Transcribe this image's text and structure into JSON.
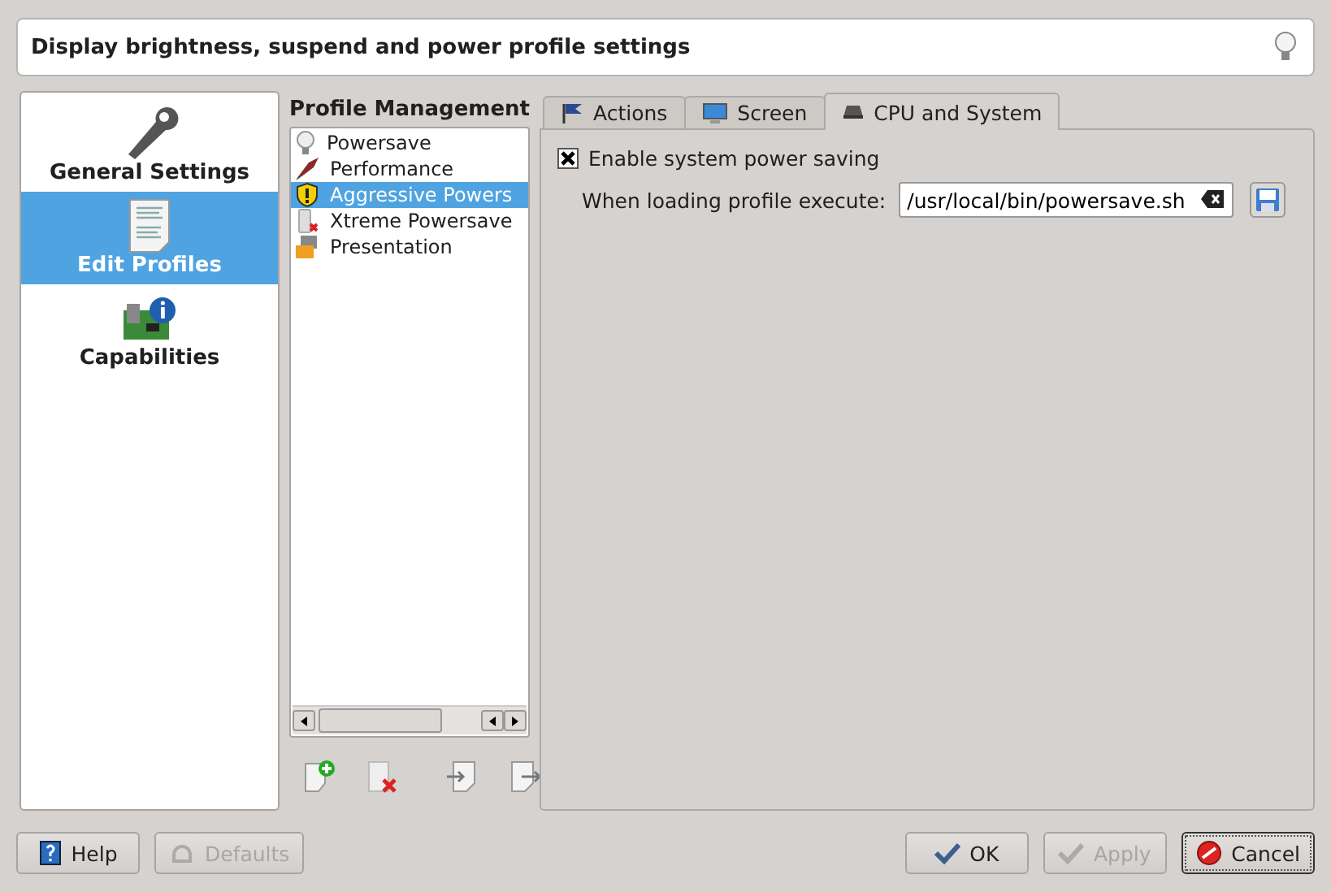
{
  "header": {
    "description": "Display brightness, suspend and power profile settings"
  },
  "sidebar": {
    "items": [
      {
        "label": "General Settings",
        "kind": "wrench",
        "selected": false
      },
      {
        "label": "Edit Profiles",
        "kind": "document",
        "selected": true
      },
      {
        "label": "Capabilities",
        "kind": "card",
        "selected": false
      }
    ]
  },
  "profiles": {
    "title": "Profile Management",
    "items": [
      {
        "label": "Powersave",
        "kind": "bulb",
        "selected": false
      },
      {
        "label": "Performance",
        "kind": "rocket",
        "selected": false
      },
      {
        "label": "Aggressive Powers",
        "kind": "shield",
        "selected": true
      },
      {
        "label": "Xtreme Powersave",
        "kind": "battery",
        "selected": false
      },
      {
        "label": "Presentation",
        "kind": "projector",
        "selected": false
      }
    ]
  },
  "tabs": [
    {
      "label": "Actions",
      "kind": "flag",
      "selected": false
    },
    {
      "label": "Screen",
      "kind": "monitor",
      "selected": false
    },
    {
      "label": "CPU and System",
      "kind": "chip",
      "selected": true
    }
  ],
  "cpu_system": {
    "checkbox": {
      "label": "Enable system power saving",
      "checked": true
    },
    "field": {
      "label": "When loading profile execute:",
      "value": "/usr/local/bin/powersave.sh"
    }
  },
  "buttons": [
    {
      "label": "Help",
      "kind": "help",
      "disabled": false,
      "focused": false
    },
    {
      "label": "Defaults",
      "kind": "defaults",
      "disabled": true,
      "focused": false
    },
    {
      "label": "OK",
      "kind": "ok",
      "disabled": false,
      "focused": false
    },
    {
      "label": "Apply",
      "kind": "apply",
      "disabled": true,
      "focused": false
    },
    {
      "label": "Cancel",
      "kind": "cancel",
      "disabled": false,
      "focused": true
    }
  ]
}
